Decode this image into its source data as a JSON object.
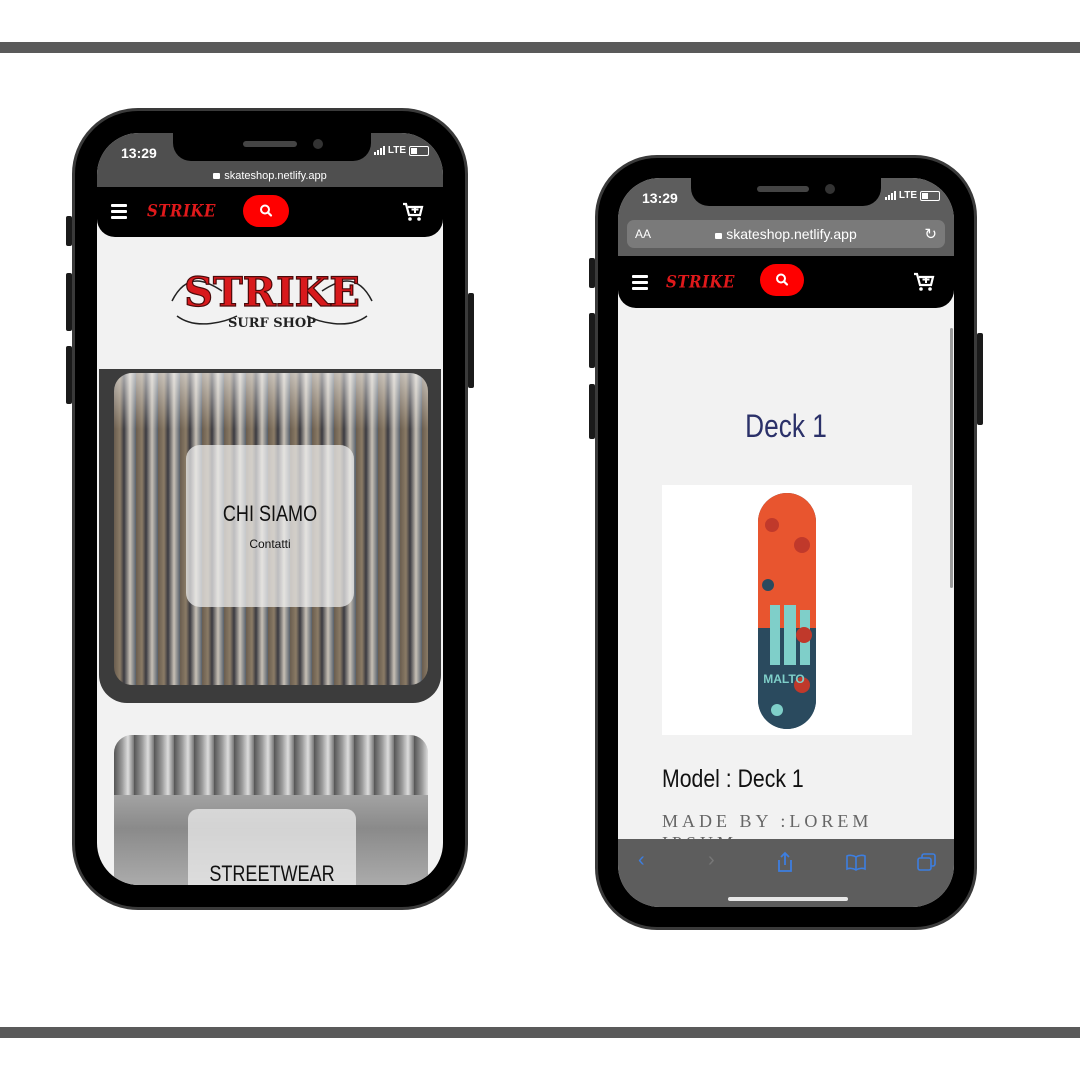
{
  "phone_left": {
    "status": {
      "time": "13:29",
      "carrier": "LTE"
    },
    "url": "skateshop.netlify.app",
    "logo": {
      "title": "STRIKE",
      "subtitle": "SURF SHOP"
    },
    "cards": [
      {
        "heading": "CHI SIAMO",
        "subheading": "Contatti"
      },
      {
        "heading": "STREETWEAR",
        "subheading": ""
      }
    ]
  },
  "phone_right": {
    "status": {
      "time": "13:29",
      "carrier": "LTE"
    },
    "url_bar": {
      "text_size_label": "AA",
      "address": "skateshop.netlify.app"
    },
    "product": {
      "title": "Deck 1",
      "model": "Model : Deck 1",
      "made_by": "MADE BY :LOREM IPSUM",
      "deck_print_text": "MALTO",
      "deck_colors": [
        "#e8552f",
        "#2a4a5e",
        "#7fcfc9",
        "#c0392b"
      ]
    }
  },
  "nav": {
    "logo_text": "STRIKE"
  },
  "icons": [
    "hamburger-icon",
    "search-icon",
    "cart-icon",
    "lock-icon",
    "reload-icon",
    "back-icon",
    "forward-icon",
    "share-icon",
    "bookmarks-icon",
    "tabs-icon"
  ],
  "colors": {
    "nav_bg": "#000000",
    "search_btn": "#ff0000",
    "title_navy": "#2b3169",
    "logo_red": "#e0191b"
  }
}
